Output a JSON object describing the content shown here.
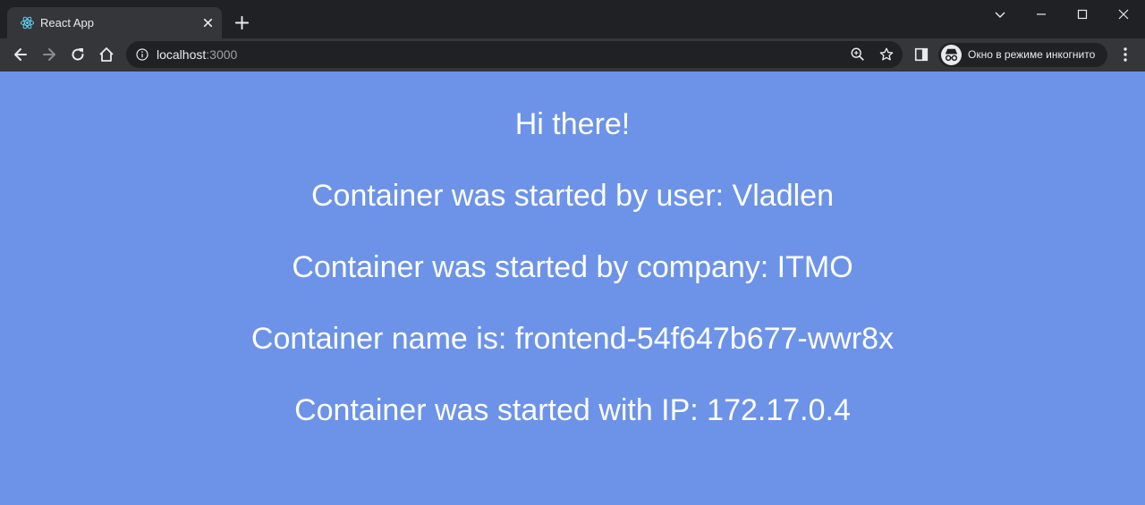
{
  "browser": {
    "tab": {
      "title": "React App",
      "favicon": "react-logo-icon"
    },
    "address": {
      "host": "localhost",
      "port": ":3000"
    },
    "incognito_label": "Окно в режиме инкогнито",
    "colors": {
      "frame": "#202124",
      "toolbar": "#35363a",
      "text": "#e8eaed",
      "muted": "#9aa0a6"
    }
  },
  "page": {
    "background": "#6c93e8",
    "greeting": "Hi there!",
    "user_line": "Container was started by user: Vladlen",
    "company_line": "Container was started by company: ITMO",
    "name_line": "Container name is: frontend-54f647b677-wwr8x",
    "ip_line": "Container was started with IP: 172.17.0.4"
  }
}
